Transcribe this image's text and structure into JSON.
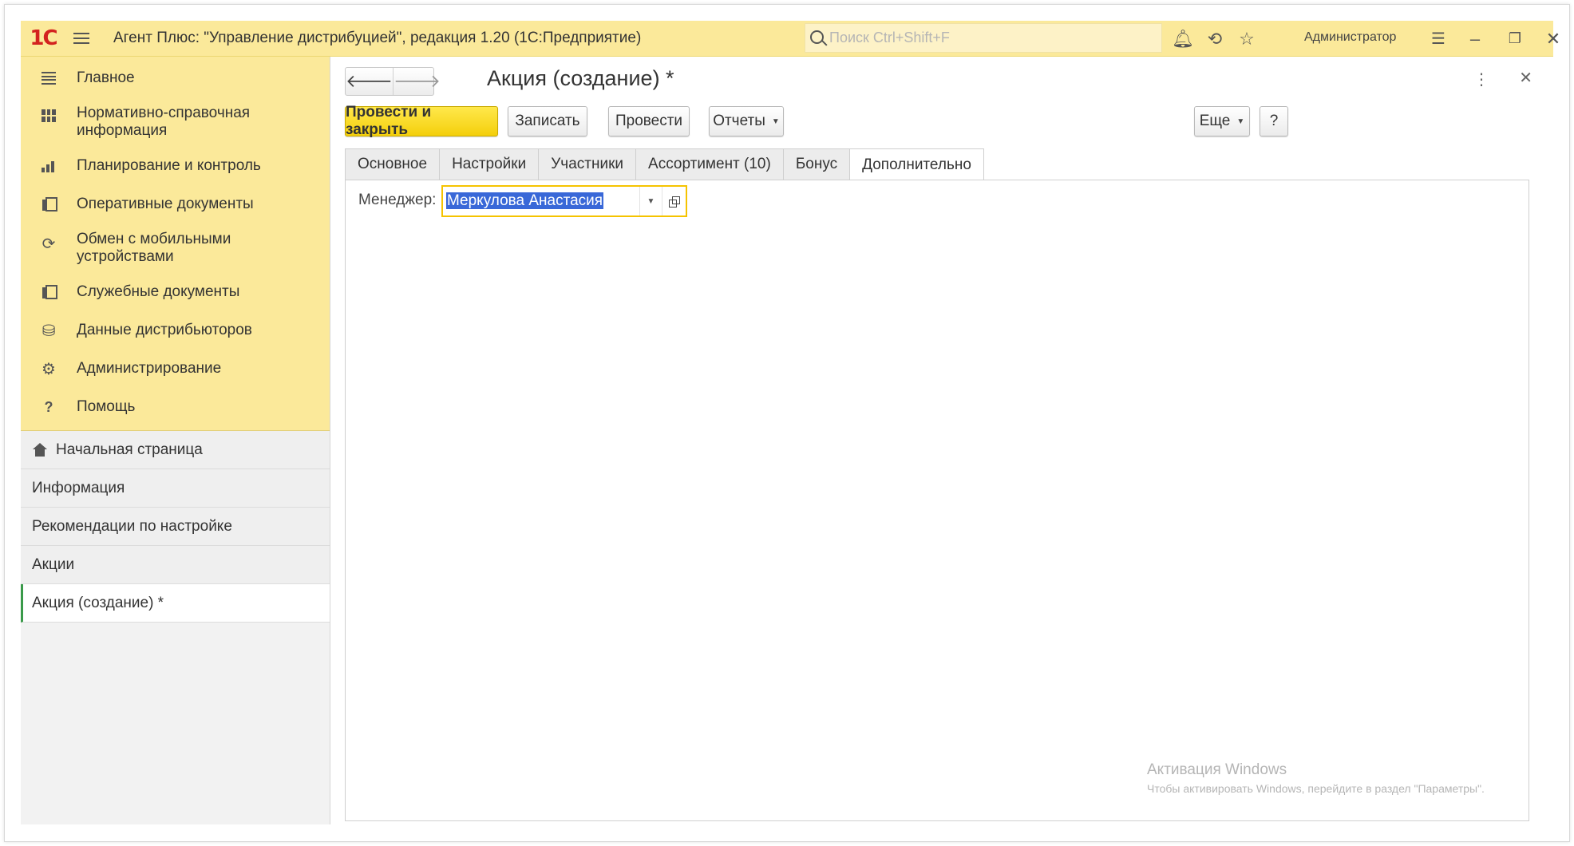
{
  "app": {
    "logo": "1С",
    "title": "Агент Плюс: \"Управление дистрибуцией\", редакция 1.20  (1С:Предприятие)",
    "search_placeholder": "Поиск Ctrl+Shift+F",
    "user": "Администратор"
  },
  "sidebar": {
    "sections": [
      {
        "label": "Главное",
        "icon": "menu-lines-icon"
      },
      {
        "label": "Нормативно-справочная информация",
        "icon": "catalog-grid-icon"
      },
      {
        "label": "Планирование и контроль",
        "icon": "bar-chart-icon"
      },
      {
        "label": "Оперативные документы",
        "icon": "documents-icon"
      },
      {
        "label": "Обмен с мобильными устройствами",
        "icon": "sync-icon"
      },
      {
        "label": "Служебные документы",
        "icon": "service-docs-icon"
      },
      {
        "label": "Данные дистрибьюторов",
        "icon": "distributor-data-icon"
      },
      {
        "label": "Администрирование",
        "icon": "gear-icon"
      },
      {
        "label": "Помощь",
        "icon": "question-icon"
      }
    ],
    "open_windows": [
      {
        "label": "Начальная страница"
      },
      {
        "label": "Информация"
      },
      {
        "label": "Рекомендации по настройке"
      },
      {
        "label": "Акции"
      },
      {
        "label": "Акция (создание) *"
      }
    ]
  },
  "form": {
    "title": "Акция (создание) *",
    "nav_back": "🡐",
    "nav_forward": "🡒",
    "buttons": {
      "post_and_close": "Провести и закрыть",
      "save": "Записать",
      "post": "Провести",
      "reports": "Отчеты",
      "more": "Еще",
      "help": "?"
    },
    "tabs": [
      {
        "label": "Основное"
      },
      {
        "label": "Настройки"
      },
      {
        "label": "Участники"
      },
      {
        "label": "Ассортимент (10)"
      },
      {
        "label": "Бонус"
      },
      {
        "label": "Дополнительно"
      }
    ],
    "active_tab": "Дополнительно",
    "manager_label": "Менеджер:",
    "manager_value": "Меркулова Анастасия"
  },
  "watermark": {
    "line1": "Активация Windows",
    "line2": "Чтобы активировать Windows, перейдите в раздел \"Параметры\"."
  },
  "colors": {
    "header_bg": "#fbe99a",
    "primary_button": "#f4cf0c",
    "selection": "#3968d8",
    "active_marker": "#3a9a4a"
  }
}
